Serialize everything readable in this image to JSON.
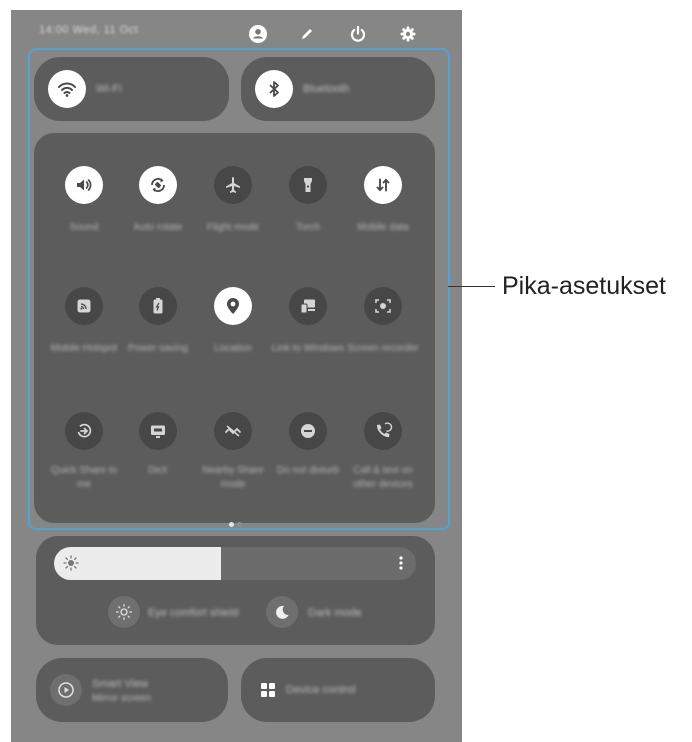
{
  "status_bar": {
    "time_date": "14:00 Wed, 11 Oct",
    "icons": [
      "user-icon",
      "pencil-icon",
      "power-icon",
      "gear-icon"
    ]
  },
  "connectivity": {
    "wifi_label": "Wi-Fi",
    "bluetooth_label": "Bluetooth"
  },
  "quick_settings": [
    {
      "label": "Sound",
      "icon": "sound-icon",
      "active": true
    },
    {
      "label": "Auto rotate",
      "icon": "auto-rotate-icon",
      "active": true
    },
    {
      "label": "Flight mode",
      "icon": "airplane-icon",
      "active": false
    },
    {
      "label": "Torch",
      "icon": "torch-icon",
      "active": false
    },
    {
      "label": "Mobile data",
      "icon": "mobile-data-icon",
      "active": true
    },
    {
      "label": "Mobile Hotspot",
      "icon": "hotspot-icon",
      "active": false
    },
    {
      "label": "Power saving",
      "icon": "power-saving-icon",
      "active": false
    },
    {
      "label": "Location",
      "icon": "location-icon",
      "active": true
    },
    {
      "label": "Link to Windows",
      "icon": "link-to-windows-icon",
      "active": false
    },
    {
      "label": "Screen recorder",
      "icon": "screen-recorder-icon",
      "active": false
    },
    {
      "label": "Quick Share to me",
      "icon": "quick-share-icon",
      "active": false
    },
    {
      "label": "DeX",
      "icon": "dex-icon",
      "active": false
    },
    {
      "label": "Nearby Share mode",
      "icon": "nearby-share-icon",
      "active": false
    },
    {
      "label": "Do not disturb",
      "icon": "do-not-disturb-icon",
      "active": false
    },
    {
      "label": "Call & text on other devices",
      "icon": "call-text-icon",
      "active": false
    }
  ],
  "brightness": {
    "level": 0.46
  },
  "display_modes": {
    "eye_comfort_label": "Eye comfort shield",
    "dark_mode_label": "Dark mode"
  },
  "bottom": {
    "smart_view_label": "Smart View",
    "smart_view_sub": "Mirror screen",
    "device_control_label": "Device control"
  },
  "callout": {
    "label": "Pika-asetukset"
  },
  "colors": {
    "highlight": "#4fa3d8",
    "panel": "#5c5c5c",
    "background": "#868686"
  }
}
